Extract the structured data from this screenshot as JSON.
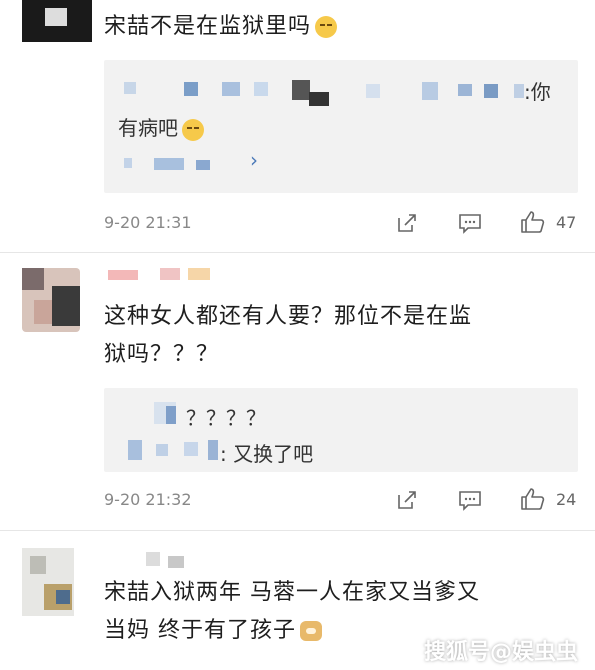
{
  "comments": [
    {
      "text": "宋喆不是在监狱里吗",
      "reply": {
        "tail": ":你",
        "line2": "有病吧",
        "more": "›"
      },
      "date": "9-20 21:31",
      "likes": "47"
    },
    {
      "text_line1": "这种女人都还有人要？那位不是在监",
      "text_line2": "狱吗？？？",
      "reply": {
        "line1": "？？？？",
        "line2": ": 又换了吧"
      },
      "date": "9-20 21:32",
      "likes": "24"
    },
    {
      "text_line1": "宋喆入狱两年 马蓉一人在家又当爹又",
      "text_line2": "当妈 终于有了孩子"
    }
  ],
  "watermark": "搜狐号@娱虫虫",
  "icons": [
    "share-icon",
    "comment-icon",
    "like-icon",
    "smile-emoji",
    "dizzy-emoji",
    "dog-emoji"
  ]
}
